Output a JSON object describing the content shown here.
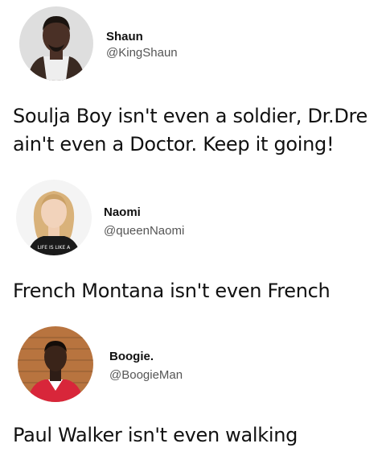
{
  "posts": [
    {
      "name": "Shaun",
      "handle": "@KingShaun",
      "text": "Soulja Boy isn't even a soldier, Dr.Dre ain't even a Doctor. Keep it going!"
    },
    {
      "name": "Naomi",
      "handle": "@queenNaomi",
      "text": "French Montana isn't even French",
      "avatar_shirt_text": "LIFE IS LIKE A"
    },
    {
      "name": "Boogie.",
      "handle": "@BoogieMan",
      "text": "Paul Walker isn't even walking"
    }
  ],
  "colors": {
    "text": "#111111",
    "handle": "#555555",
    "background": "#ffffff"
  }
}
